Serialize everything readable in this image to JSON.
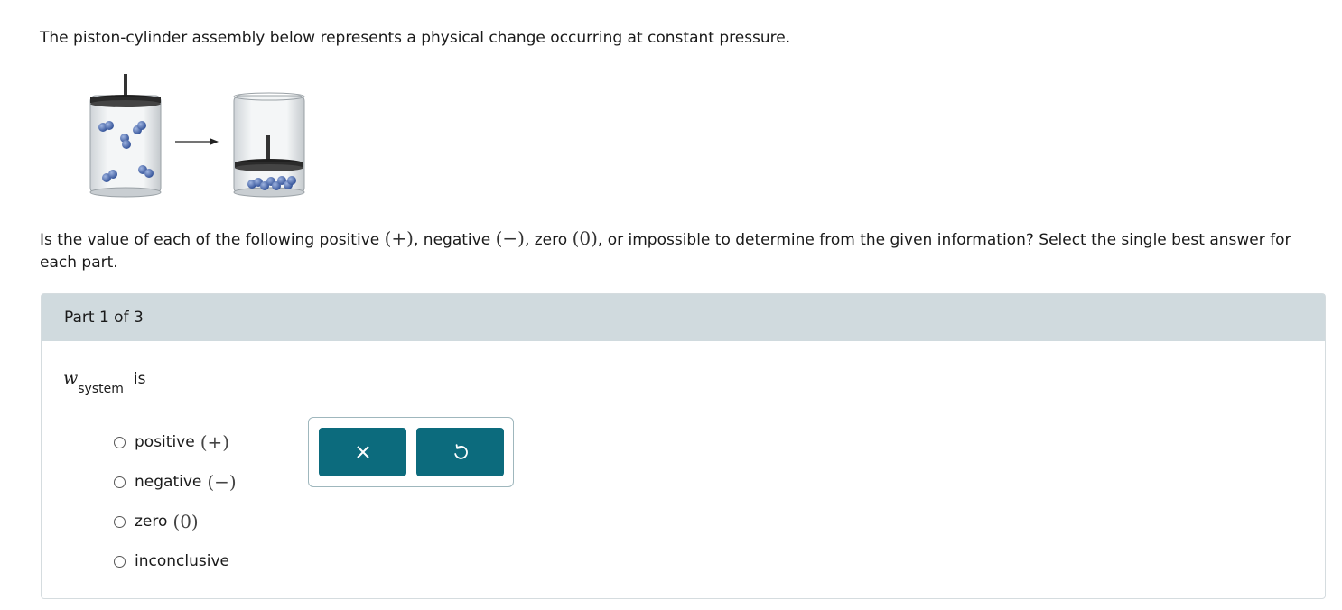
{
  "intro_text": "The piston-cylinder assembly below represents a physical change occurring at constant pressure.",
  "question": {
    "text_1": "Is the value of each of the following positive ",
    "sym_positive": "(+)",
    "text_2": ", negative ",
    "sym_negative": "(−)",
    "text_3": ", zero ",
    "sym_zero": "(0)",
    "text_4": ", or impossible to determine from the given information? Select the single best answer for each part."
  },
  "part": {
    "header": "Part 1 of 3",
    "variable_symbol": "w",
    "variable_subscript": "system",
    "variable_suffix": "is",
    "options": [
      {
        "label": "positive",
        "math": "(+)"
      },
      {
        "label": "negative",
        "math": "(−)"
      },
      {
        "label": "zero",
        "math": "(0)"
      },
      {
        "label": "inconclusive",
        "math": ""
      }
    ]
  },
  "toolbar": {
    "clear_icon": "close-icon",
    "undo_icon": "undo-icon",
    "button_color": "#0c6b7d"
  },
  "colors": {
    "header_bg": "#d0dade",
    "molecule": "#4a6bb0",
    "piston": "#222222"
  }
}
